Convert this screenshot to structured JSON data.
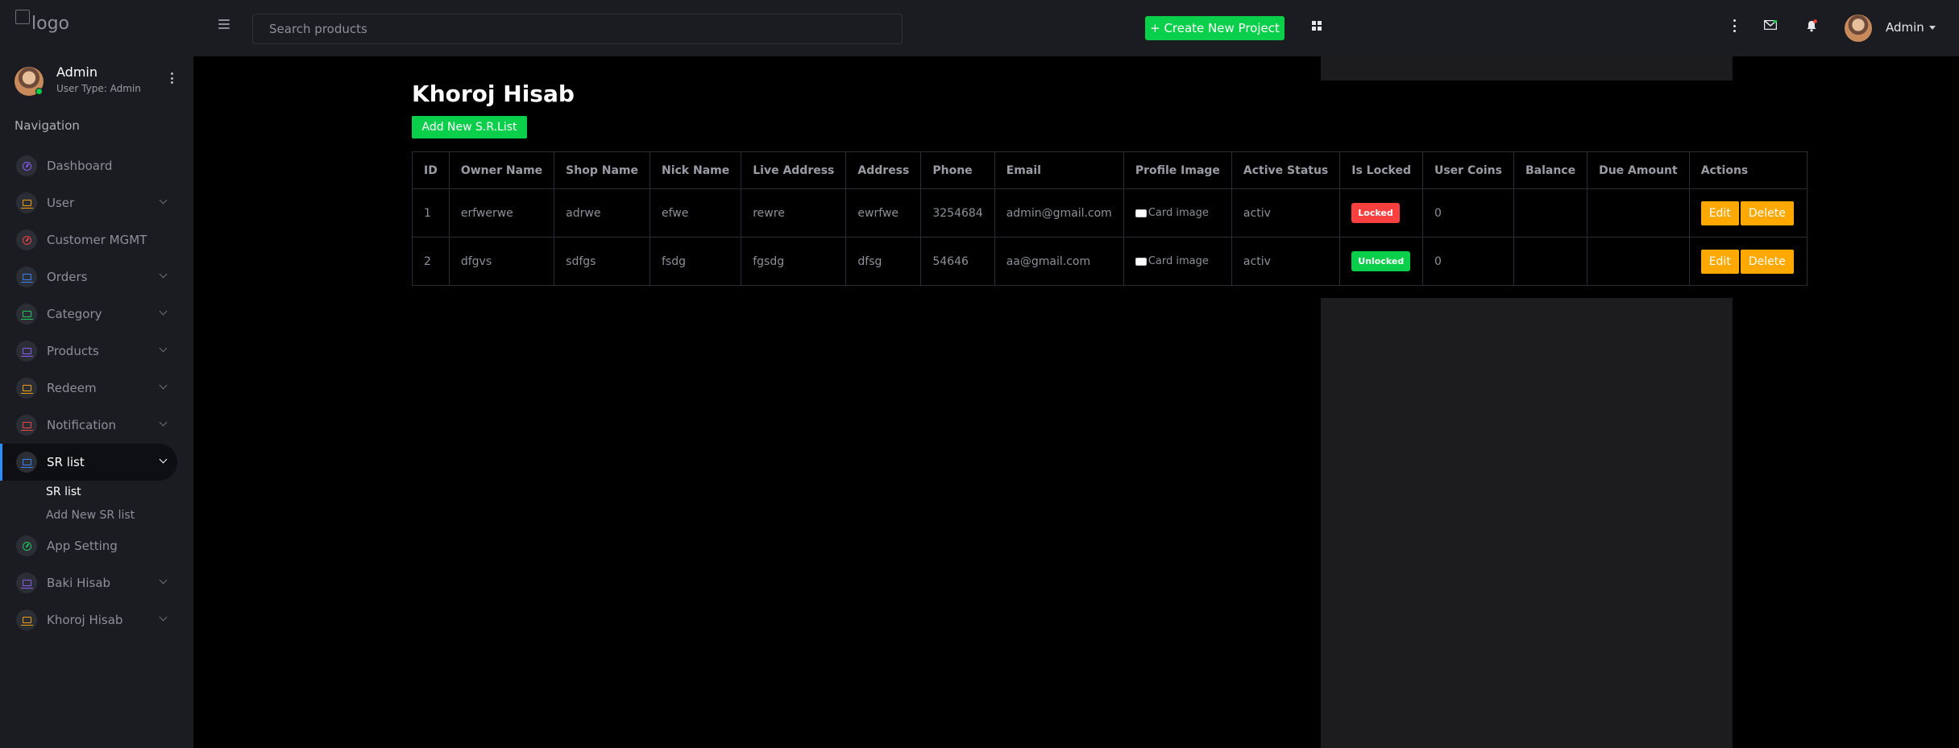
{
  "topbar": {
    "logo_alt": "logo",
    "search_placeholder": "Search products",
    "create_button": "+ Create New Project",
    "user_name": "Admin"
  },
  "sidebar": {
    "user_name": "Admin",
    "user_type": "User Type: Admin",
    "nav_title": "Navigation",
    "items": [
      {
        "label": "Dashboard",
        "icon": "gauge-icon",
        "color": "#8b5cf6",
        "has_chevron": false
      },
      {
        "label": "User",
        "icon": "laptop-icon",
        "color": "#f59e0b",
        "has_chevron": true
      },
      {
        "label": "Customer MGMT",
        "icon": "gauge-icon",
        "color": "#ef4444",
        "has_chevron": false
      },
      {
        "label": "Orders",
        "icon": "laptop-icon",
        "color": "#3b82f6",
        "has_chevron": true
      },
      {
        "label": "Category",
        "icon": "laptop-icon",
        "color": "#22c55e",
        "has_chevron": true
      },
      {
        "label": "Products",
        "icon": "laptop-icon",
        "color": "#8b5cf6",
        "has_chevron": true
      },
      {
        "label": "Redeem",
        "icon": "laptop-icon",
        "color": "#f59e0b",
        "has_chevron": true
      },
      {
        "label": "Notification",
        "icon": "laptop-icon",
        "color": "#ef4444",
        "has_chevron": true
      },
      {
        "label": "SR list",
        "icon": "laptop-icon",
        "color": "#3b82f6",
        "has_chevron": true,
        "active": true
      },
      {
        "label": "App Setting",
        "icon": "gauge-icon",
        "color": "#22c55e",
        "has_chevron": false
      },
      {
        "label": "Baki Hisab",
        "icon": "laptop-icon",
        "color": "#8b5cf6",
        "has_chevron": true
      },
      {
        "label": "Khoroj Hisab",
        "icon": "laptop-icon",
        "color": "#f59e0b",
        "has_chevron": true
      }
    ],
    "submenu": [
      "SR list",
      "Add New SR list"
    ]
  },
  "main": {
    "title": "Khoroj Hisab",
    "add_button": "Add New S.R.List",
    "columns": [
      "ID",
      "Owner Name",
      "Shop Name",
      "Nick Name",
      "Live Address",
      "Address",
      "Phone",
      "Email",
      "Profile Image",
      "Active Status",
      "Is Locked",
      "User Coins",
      "Balance",
      "Due Amount",
      "Actions"
    ],
    "rows": [
      {
        "id": "1",
        "owner": "erfwerwe",
        "shop": "adrwe",
        "nick": "efwe",
        "live": "rewre",
        "address": "ewrfwe",
        "phone": "3254684",
        "email": "admin@gmail.com",
        "image_alt": "Card image",
        "status": "activ",
        "lock": "Locked",
        "locked": true,
        "coins": "0",
        "balance": "",
        "due": ""
      },
      {
        "id": "2",
        "owner": "dfgvs",
        "shop": "sdfgs",
        "nick": "fsdg",
        "live": "fgsdg",
        "address": "dfsg",
        "phone": "54646",
        "email": "aa@gmail.com",
        "image_alt": "Card image",
        "status": "activ",
        "lock": "Unlocked",
        "locked": false,
        "coins": "0",
        "balance": "",
        "due": ""
      }
    ],
    "edit_label": "Edit",
    "delete_label": "Delete"
  }
}
